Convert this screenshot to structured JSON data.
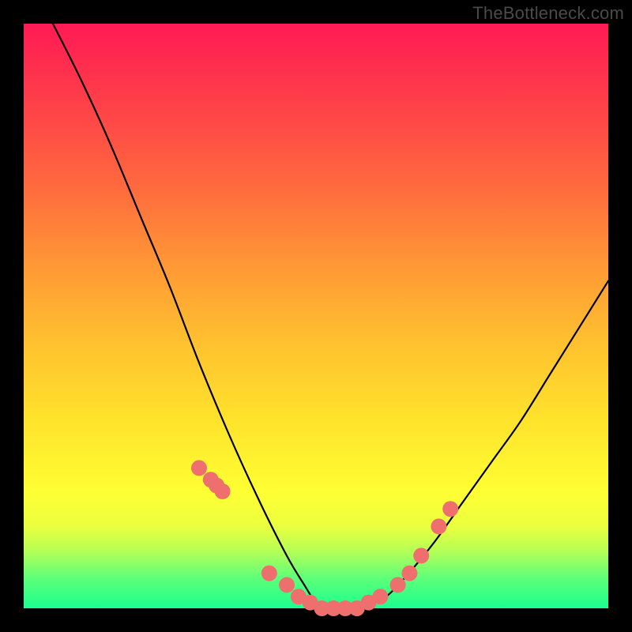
{
  "watermark": "TheBottleneck.com",
  "chart_data": {
    "type": "line",
    "title": "",
    "xlabel": "",
    "ylabel": "",
    "xlim": [
      0,
      100
    ],
    "ylim": [
      0,
      100
    ],
    "grid": false,
    "legend": false,
    "background_gradient": [
      "#ff1a54",
      "#ff9a35",
      "#ffff33",
      "#1bff8e"
    ],
    "series": [
      {
        "name": "bottleneck-curve",
        "x": [
          5,
          10,
          15,
          20,
          25,
          30,
          35,
          40,
          45,
          48,
          50,
          52,
          55,
          58,
          60,
          62,
          65,
          70,
          75,
          80,
          85,
          90,
          95,
          100
        ],
        "y": [
          100,
          90,
          79,
          67,
          55,
          42,
          30,
          19,
          9,
          4,
          1,
          0,
          0,
          0,
          1,
          2,
          5,
          11,
          18,
          25,
          32,
          40,
          48,
          56
        ]
      }
    ],
    "highlight_points": {
      "name": "highlighted-dots",
      "color": "#ef6f6f",
      "x": [
        30,
        32,
        33,
        34,
        42,
        45,
        47,
        49,
        51,
        53,
        55,
        57,
        59,
        61,
        64,
        66,
        68,
        71,
        73
      ],
      "y": [
        24,
        22,
        21,
        20,
        6,
        4,
        2,
        1,
        0,
        0,
        0,
        0,
        1,
        2,
        4,
        6,
        9,
        14,
        17
      ]
    }
  }
}
